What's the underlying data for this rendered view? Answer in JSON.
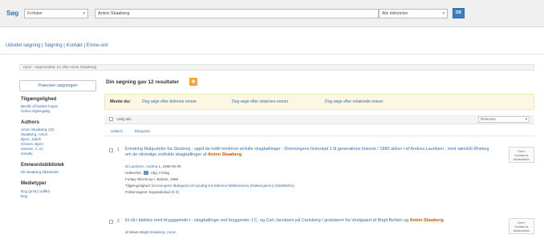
{
  "search": {
    "label": "Søg",
    "field_select": "Forfatter",
    "query": "Anton Skaaberg",
    "scope_select": "Alle biblioteker",
    "go_label": "OK"
  },
  "crumbs": {
    "links": "Udvidet søgning | Søgning | Kontakt | Emne-ord"
  },
  "path": {
    "text": "Hjem › søgeresultat: (er eller emne Skaaberg)"
  },
  "facets": {
    "button": "Præcisér søgningen",
    "groups": [
      {
        "heading": "Tilgængelighed",
        "links": [
          "Består af fysiske kopier",
          "Online tilgængelig"
        ]
      },
      {
        "heading": "Authors",
        "links": [
          "Anton Skaaberg (10)",
          "Skaaberg, Anton",
          "Bjorn, Jakob",
          "Grünes, Bjørn",
          "Hansen, A. Kr.",
          "Sokolkj"
        ]
      },
      {
        "heading": "Emneordsbibliotek",
        "links": [
          "Kb.skaaberg biblioteket"
        ]
      },
      {
        "heading": "Medietyper",
        "links": [
          "Bog (print) (udlån)",
          "Bog"
        ]
      }
    ]
  },
  "results": {
    "title": "Din søgning gav 12 resultater",
    "rss_icon": "rss-icon",
    "alert_label": "Mente du:",
    "alerts": [
      "Dog søge efter bidrente emner",
      "Dog søge efter smørrere emner",
      "Dog søge efter relaterede emner"
    ],
    "select_all": "Vælg alle",
    "sort_value": "Relevans",
    "toolbar_buttons": [
      "Udskriv",
      "Eksportér"
    ],
    "items": [
      {
        "num": "1",
        "title_pre": "Erindring Malgudebe fra Stridsvej : oppd de hidtil nimlrinet sinfulle skagbøllinger : Dronningens historiepl 1 til generations historie / 1880 aldrer i af Andrea Lauritsen ; med særskilt Ønskeg om de nitrindige sintfulde skagbøllinger af",
        "title_hl": "Anton Skaaberg",
        "meta": [
          {
            "label": "af Lauritsen, Andrea",
            "rest": "1, 1988-08-05"
          },
          {
            "label": "Udlevelse:",
            "rest": "Udg. Forlag"
          },
          {
            "label": "Forlag:",
            "rest": "Bilschoop i. Bedste, 1988"
          },
          {
            "label": "Tilgængelighed:",
            "rest": "Dronningens lådegaard af myndag 8.8 Bilerens fællelamerna (Raktevgamm) (05a960/01)"
          },
          {
            "label": "Polkemaginet:",
            "rest": "Bogsødsdiad (2-3)"
          }
        ],
        "side": [
          "Gem i",
          "Kontakt os",
          "Afhændelser"
        ]
      },
      {
        "num": "2",
        "title_pre": "Et så i blektes med brygggeinde t : skagbøllinge ved bryggenter J.C. og Carl Jacobsen på Carlsberg / gratisteret fra Vestgaard af Birgit Bellam og",
        "title_hl": "Anton Skaaberg",
        "meta": [
          {
            "label": "af Skans Birgit",
            "rest": "Skaaberg, Anton"
          }
        ],
        "side": [
          "Gem i",
          "Kontakt os",
          "Afhændelser"
        ]
      }
    ]
  },
  "colors": {
    "link": "#3a6fa5",
    "highlight": "#d35400",
    "button": "#3a7fc1",
    "alert_bg": "#fbf7e3"
  }
}
